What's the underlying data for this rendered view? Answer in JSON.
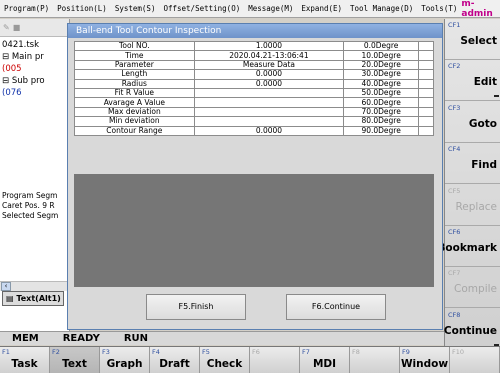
{
  "menubar": {
    "items": [
      "Program(P)",
      "Position(L)",
      "System(S)",
      "Offset/Setting(O)",
      "Message(M)",
      "Expand(E)",
      "Tool Manage(D)",
      "Tools(T)"
    ],
    "user": "m-admin"
  },
  "left_panel": {
    "toolbar_icons": [
      "edit-icon",
      "save-icon"
    ],
    "tree": [
      {
        "text": "0421.tsk",
        "class": ""
      },
      {
        "text": "⊟ Main pr",
        "class": ""
      },
      {
        "text": "    (005",
        "class": "red"
      },
      {
        "text": "⊟ Sub pro",
        "class": ""
      },
      {
        "text": "    (076",
        "class": "blue"
      }
    ],
    "info_lines": [
      "Program Segm",
      "Caret Pos. 9 R",
      "Selected Segm"
    ],
    "text_tab": "Text(Alt1)"
  },
  "dialog": {
    "title": "Ball-end Tool Contour Inspection",
    "rows": [
      {
        "label": "Tool NO.",
        "value": "1.0000",
        "angle": "0.0Degre"
      },
      {
        "label": "Time",
        "value": "2020.04.21-13:06:41",
        "angle": "10.0Degre"
      },
      {
        "label": "Parameter",
        "value": "Measure Data",
        "angle": "20.0Degre"
      },
      {
        "label": "Length",
        "value": "0.0000",
        "angle": "30.0Degre"
      },
      {
        "label": "Radius",
        "value": "0.0000",
        "angle": "40.0Degre"
      },
      {
        "label": "Fit R Value",
        "value": "",
        "angle": "50.0Degre"
      },
      {
        "label": "Avarage A Value",
        "value": "",
        "angle": "60.0Degre"
      },
      {
        "label": "Max deviation",
        "value": "",
        "angle": "70.0Degre"
      },
      {
        "label": "Min deviation",
        "value": "",
        "angle": "80.0Degre"
      },
      {
        "label": "Contour Range",
        "value": "0.0000",
        "angle": "90.0Degre"
      }
    ],
    "finish_label": "F5.Finish",
    "continue_label": "F6.Continue"
  },
  "right_softkeys": [
    {
      "num": "CF1",
      "label": "Select",
      "disabled": false
    },
    {
      "num": "CF2",
      "label": "Edit",
      "disabled": false
    },
    {
      "num": "CF3",
      "label": "Goto",
      "disabled": false
    },
    {
      "num": "CF4",
      "label": "Find",
      "disabled": false
    },
    {
      "num": "CF5",
      "label": "Replace",
      "disabled": true
    },
    {
      "num": "CF6",
      "label": "Bookmark",
      "disabled": false
    },
    {
      "num": "CF7",
      "label": "Compile",
      "disabled": true
    },
    {
      "num": "CF8",
      "label": "Continue",
      "disabled": false
    }
  ],
  "status": [
    "MEM",
    "READY",
    "RUN"
  ],
  "bottom_softkeys": [
    {
      "num": "F1",
      "label": "Task"
    },
    {
      "num": "F2",
      "label": "Text",
      "active": true
    },
    {
      "num": "F3",
      "label": "Graph"
    },
    {
      "num": "F4",
      "label": "Draft"
    },
    {
      "num": "F5",
      "label": "Check"
    },
    {
      "num": "F6",
      "label": ""
    },
    {
      "num": "F7",
      "label": "MDI"
    },
    {
      "num": "F8",
      "label": ""
    },
    {
      "num": "F9",
      "label": "Window"
    },
    {
      "num": "F10",
      "label": ""
    }
  ]
}
